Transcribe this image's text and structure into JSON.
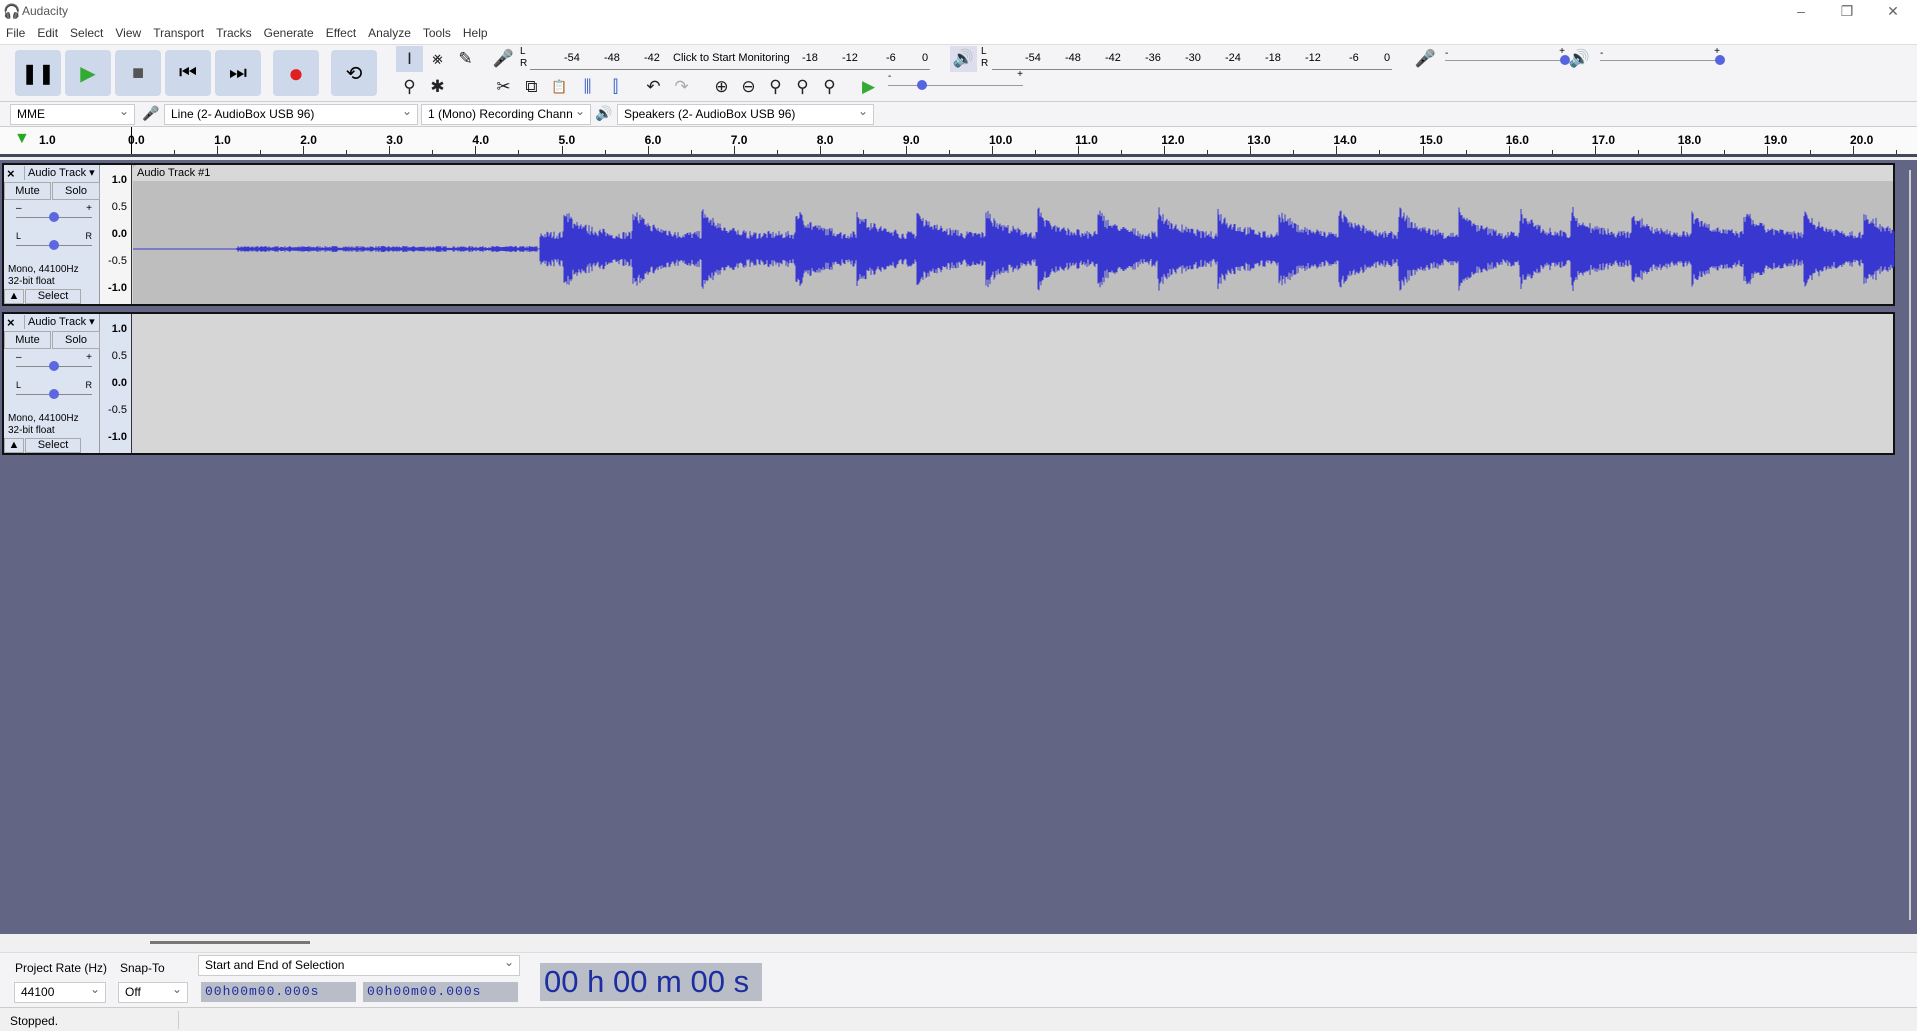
{
  "window": {
    "title": "Audacity",
    "min": "–",
    "restore": "❐",
    "close": "✕"
  },
  "menu": [
    "File",
    "Edit",
    "Select",
    "View",
    "Transport",
    "Tracks",
    "Generate",
    "Effect",
    "Analyze",
    "Tools",
    "Help"
  ],
  "transport": {
    "pause": "❚❚",
    "play": "▶",
    "stop": "■",
    "skip_start": "⏮",
    "skip_end": "⏭",
    "record": "●",
    "loop": "⟲"
  },
  "tools": {
    "select": "I",
    "envelope": "⨳",
    "draw": "✎",
    "zoom": "⚲",
    "multi": "✱"
  },
  "edit_tools": {
    "cut": "✂",
    "copy": "⧉",
    "paste": "📋",
    "trim": "⫼",
    "silence": "⫿",
    "undo": "↶",
    "redo": "↷",
    "zoom_in": "⊕",
    "zoom_out": "⊖",
    "fit_sel": "⚲",
    "fit_proj": "⚲",
    "zoom_toggle": "⚲",
    "play_at_speed": "▶"
  },
  "record_meter": {
    "ticks": [
      "-54",
      "-48",
      "-42",
      "-18",
      "-12",
      "-6",
      "0"
    ],
    "prompt": "Click to Start Monitoring"
  },
  "play_meter": {
    "ticks": [
      "-54",
      "-48",
      "-42",
      "-36",
      "-30",
      "-24",
      "-18",
      "-12",
      "-6",
      "0"
    ]
  },
  "mixer": {
    "minus": "-",
    "plus": "+",
    "record_volume": 1.0,
    "playback_volume": 1.0
  },
  "play_speed": {
    "minus": "-",
    "plus": "+",
    "value": 0.25
  },
  "device": {
    "host": "MME",
    "input": "Line (2- AudioBox USB 96)",
    "channels": "1 (Mono) Recording Chann",
    "output": "Speakers (2- AudioBox USB 96)"
  },
  "ruler": {
    "labels": [
      "1.0",
      "0.0",
      "1.0",
      "2.0",
      "3.0",
      "4.0",
      "5.0",
      "6.0",
      "7.0",
      "8.0",
      "9.0",
      "10.0",
      "11.0",
      "12.0",
      "13.0",
      "14.0",
      "15.0",
      "16.0",
      "17.0",
      "18.0",
      "19.0",
      "20.0"
    ]
  },
  "tracks": [
    {
      "name": "Audio Track",
      "clip": "Audio Track #1",
      "mute": "Mute",
      "solo": "Solo",
      "info1": "Mono, 44100Hz",
      "info2": "32-bit float",
      "select": "Select",
      "gain": 0.5,
      "pan": 0.5,
      "scale": [
        "1.0",
        "0.5",
        "0.0",
        "-0.5",
        "-1.0"
      ]
    },
    {
      "name": "Audio Track",
      "clip": "",
      "mute": "Mute",
      "solo": "Solo",
      "info1": "Mono, 44100Hz",
      "info2": "32-bit float",
      "select": "Select",
      "gain": 0.5,
      "pan": 0.5,
      "scale": [
        "1.0",
        "0.5",
        "0.0",
        "-0.5",
        "-1.0"
      ]
    }
  ],
  "selection": {
    "rate_label": "Project Rate (Hz)",
    "snap_label": "Snap-To",
    "rate": "44100",
    "snap": "Off",
    "mode": "Start and End of Selection",
    "start": "00h00m00.000s",
    "end": "00h00m00.000s",
    "audio_position": "00 h 00 m 00 s"
  },
  "status": "Stopped.",
  "colors": {
    "wave": "#3838d0",
    "background": "#626684",
    "button": "#cdd8ea"
  }
}
